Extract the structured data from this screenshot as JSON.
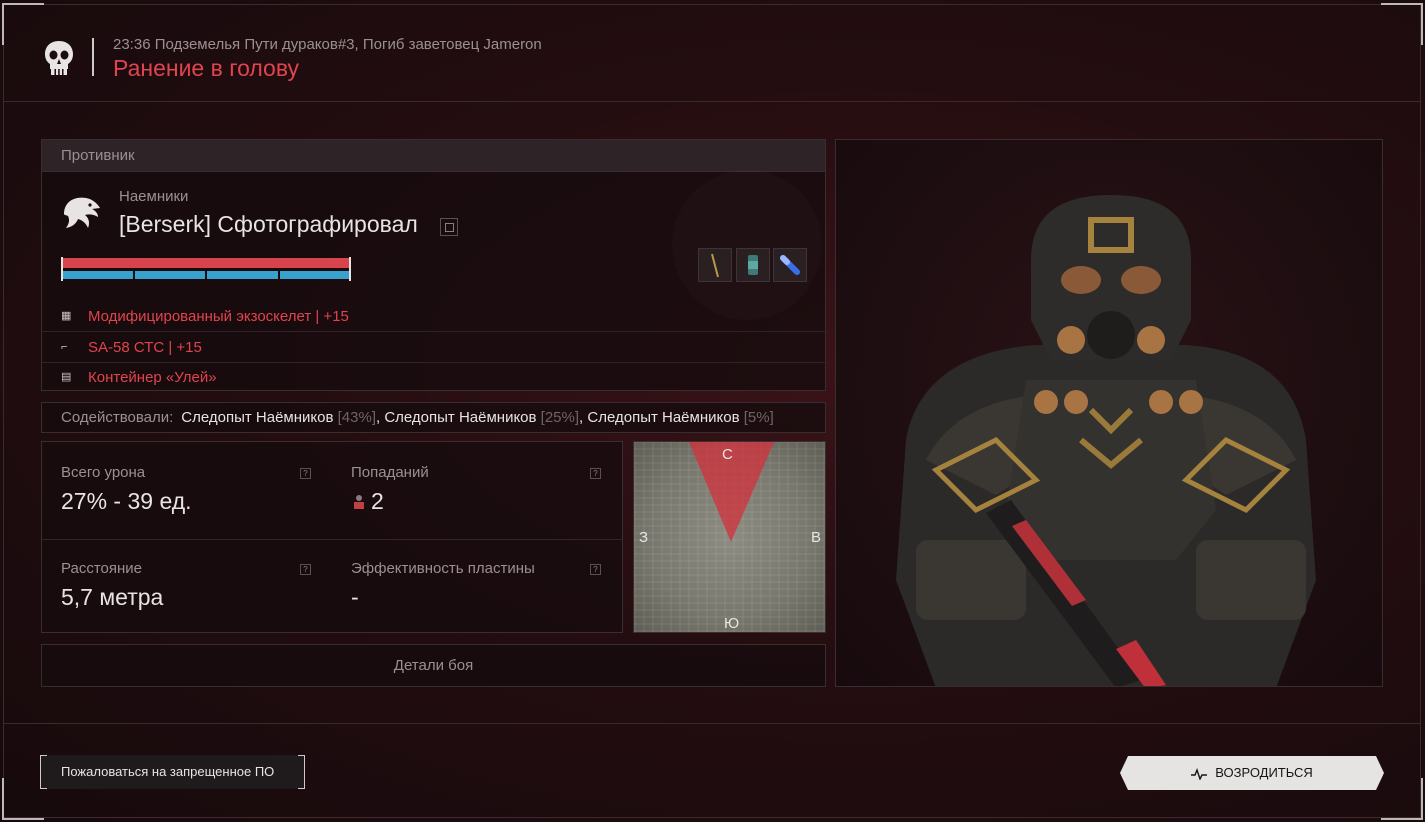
{
  "header": {
    "subtitle": "23:36 Подземелья Пути дураков#3, Погиб заветовец Jameron",
    "title": "Ранение в голову",
    "icon": "skull-icon"
  },
  "enemy": {
    "section_label": "Противник",
    "faction": "Наемники",
    "name": "[Berserk] Сфотографировал",
    "health_fraction": 1.0,
    "armor_segments": 4,
    "quick_slots": [
      "knife-item-icon",
      "canister-item-icon",
      "syringe-item-icon"
    ],
    "gear": [
      {
        "icon": "armor-icon",
        "label": "Модифицированный экзоскелет | +15"
      },
      {
        "icon": "rifle-icon",
        "label": "SA-58 СТС | +15"
      },
      {
        "icon": "container-icon",
        "label": "Контейнер «Улей»"
      }
    ]
  },
  "assist": {
    "label": "Содействовали:",
    "players": [
      {
        "name": "Следопыт Наёмников",
        "pct": "[43%]",
        "sep": ", "
      },
      {
        "name": "Следопыт Наёмников",
        "pct": "[25%]",
        "sep": ", "
      },
      {
        "name": "Следопыт Наёмников",
        "pct": "[5%]",
        "sep": ""
      }
    ]
  },
  "stats": {
    "total_damage_label": "Всего урона",
    "total_damage_value": "27% - 39 ед.",
    "hits_label": "Попаданий",
    "hits_value": "2",
    "distance_label": "Расстояние",
    "distance_value": "5,7 метра",
    "plate_label": "Эффективность пластины",
    "plate_value": "-",
    "help_glyph": "?"
  },
  "minimap": {
    "n": "С",
    "s": "Ю",
    "w": "З",
    "e": "В"
  },
  "details_button": "Детали боя",
  "footer": {
    "report_button": "Пожаловаться на запрещенное ПО",
    "respawn_button": "ВОЗРОДИТЬСЯ"
  },
  "colors": {
    "accent_red": "#e0444e",
    "armor_blue": "#3aa0cc"
  }
}
